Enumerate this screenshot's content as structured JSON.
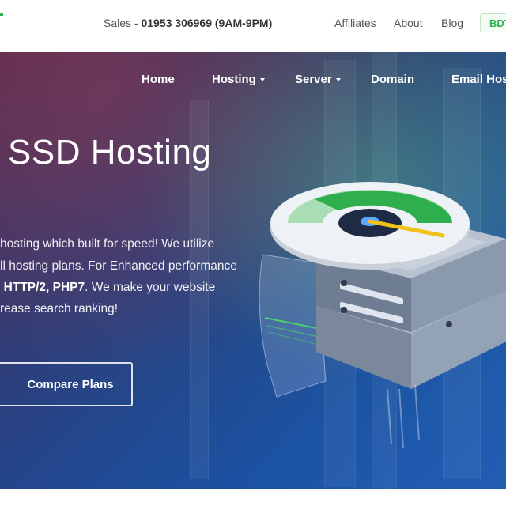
{
  "topbar": {
    "sales_prefix": "Sales - ",
    "sales_phone": "01953 306969 (9AM-9PM)",
    "links": [
      "Affiliates",
      "About",
      "Blog"
    ],
    "currency": "BDT"
  },
  "nav": {
    "items": [
      {
        "label": "Home"
      },
      {
        "label": "Hosting"
      },
      {
        "label": "Server"
      },
      {
        "label": "Domain"
      },
      {
        "label": "Email Hos"
      }
    ]
  },
  "hero": {
    "title": "SSD Hosting",
    "line1": "hosting which built for speed! We utilize",
    "line2": "ll hosting plans. For Enhanced performance",
    "line3_bold": "HTTP/2, PHP7",
    "line3_rest": ". We make your website",
    "line4": "rease search ranking!",
    "cta": "Compare Plans"
  },
  "colors": {
    "accent": "#2bb34a",
    "gauge_green": "#2fae4e",
    "needle": "#f2c21b"
  },
  "icons": [
    "speedometer-illustration",
    "server-illustration"
  ]
}
